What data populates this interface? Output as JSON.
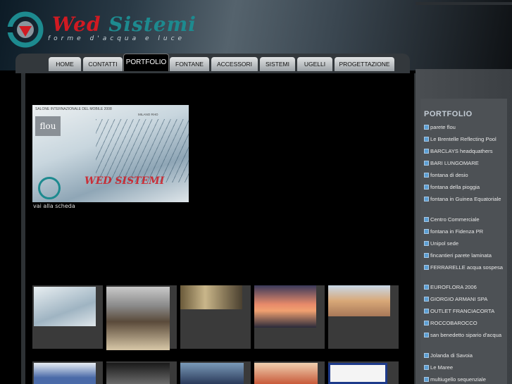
{
  "brand": {
    "name_part1": "Wed",
    "name_part2": " Sistemi",
    "tagline": "forme d'acqua e luce"
  },
  "colors": {
    "brand_red": "#d11a22",
    "brand_teal": "#1d8a8f",
    "accent_blue": "#5b9fd4"
  },
  "nav": {
    "tabs": [
      {
        "label": "HOME"
      },
      {
        "label": "CONTATTI"
      },
      {
        "label": "PORTFOLIO",
        "active": true
      },
      {
        "label": "FONTANE"
      },
      {
        "label": "ACCESSORI"
      },
      {
        "label": "SISTEMI"
      },
      {
        "label": "UGELLI"
      },
      {
        "label": "PROGETTAZIONE"
      }
    ]
  },
  "main": {
    "photo_header": "SALONE INTERNAZIONALE DEL MOBILE   2008",
    "photo_subheader": "MILANO RHO",
    "photo_flou": "flou",
    "photo_brand": "WED SISTEMI",
    "link_label": "vai alla scheda"
  },
  "sidebar": {
    "title": "PORTFOLIO",
    "items": [
      {
        "label": "parete flou"
      },
      {
        "label": "Le Brentelle Reflecting Pool"
      },
      {
        "label": "BARCLAYS headquathers"
      },
      {
        "label": "BARI LUNGOMARE"
      },
      {
        "label": "fontana di desio"
      },
      {
        "label": "fontana della pioggia"
      },
      {
        "label": "fontana in Guinea Equatoriale"
      },
      {
        "label": "Centro Commerciale"
      },
      {
        "label": "fontana in Fidenza PR"
      },
      {
        "label": "Unipol sede"
      },
      {
        "label": "fincantieri parete laminata"
      },
      {
        "label": "FERRARELLE acqua sospesa"
      },
      {
        "label": "EUROFLORA 2006"
      },
      {
        "label": "GIORGIO ARMANI SPA"
      },
      {
        "label": "OUTLET FRANCIACORTA"
      },
      {
        "label": "ROCCOBAROCCO"
      },
      {
        "label": "san benedetto sipario d'acqua"
      },
      {
        "label": "Jolanda di Savoia"
      },
      {
        "label": "Le Maree"
      },
      {
        "label": "multiugello sequenziale"
      }
    ]
  }
}
